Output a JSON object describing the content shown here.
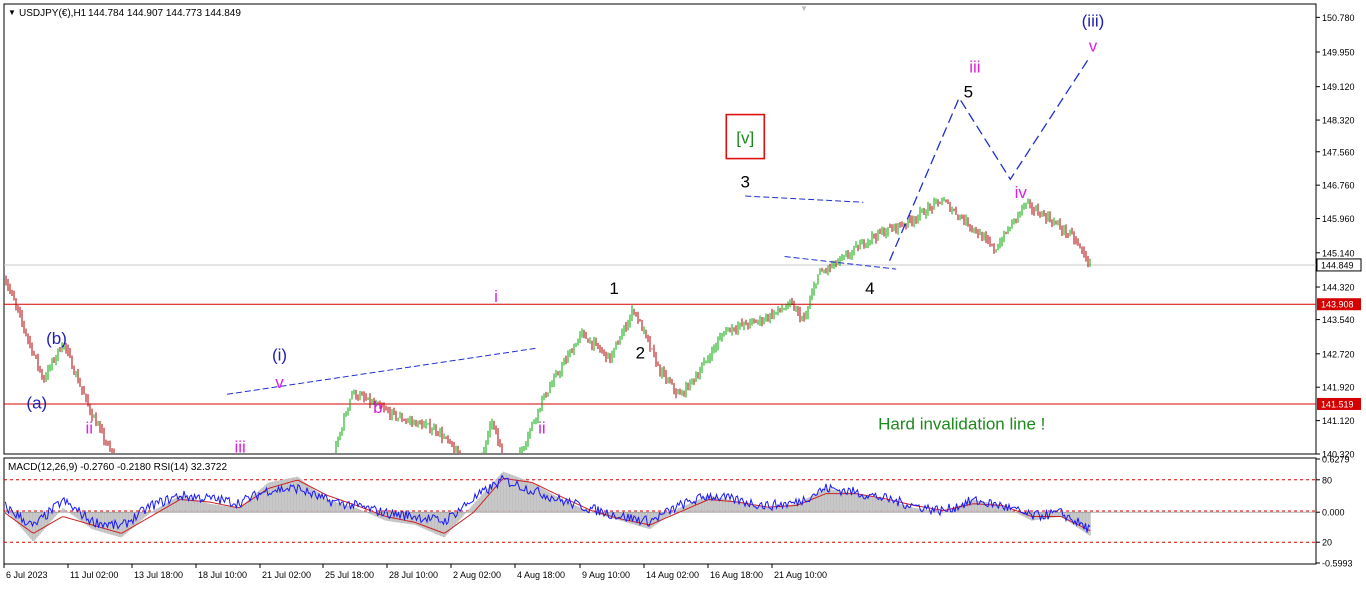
{
  "header": {
    "symbol_text": "USDJPY(€),H1",
    "ohlc_text": "144.784 144.907 144.773 144.849"
  },
  "indicator_header": {
    "text": "MACD(12,26,9) -0.2760 -0.2180 RSI(14) 32.3722"
  },
  "colors": {
    "bull": "#00aa00",
    "bear": "#b00000",
    "hline": "#d40000",
    "projection": "#1f2fd0",
    "blue_label": "#1f1fb0",
    "magenta_label": "#e020e0",
    "green_text": "#1d8a1d",
    "red_box": "#e01010",
    "rsi": "#1a1aff",
    "signal": "#cc2222",
    "hist": "#c0c0c0"
  },
  "chart_data": [
    {
      "type": "candlestick",
      "title": "",
      "symbol": "USDJPY(€)",
      "timeframe": "H1",
      "ohlc": {
        "open": 144.784,
        "high": 144.907,
        "low": 144.773,
        "close": 144.849
      },
      "ylim": [
        140.32,
        151.1
      ],
      "y_ticks": [
        "150.780",
        "149.950",
        "149.120",
        "148.320",
        "147.560",
        "146.760",
        "145.960",
        "145.140",
        "144.320",
        "143.540",
        "142.720",
        "141.920",
        "141.120",
        "140.320"
      ],
      "x_ticks": [
        "6 Jul 2023",
        "11 Jul 02:00",
        "13 Jul 18:00",
        "18 Jul 10:00",
        "21 Jul 02:00",
        "25 Jul 18:00",
        "28 Jul 10:00",
        "2 Aug 02:00",
        "4 Aug 18:00",
        "9 Aug 10:00",
        "14 Aug 02:00",
        "16 Aug 18:00",
        "21 Aug 10:00"
      ],
      "price_path": [
        {
          "t": 0,
          "p": 144.6
        },
        {
          "t": 0.03,
          "p": 142.1
        },
        {
          "t": 0.045,
          "p": 143.0
        },
        {
          "t": 0.065,
          "p": 141.4
        },
        {
          "t": 0.09,
          "p": 139.8
        },
        {
          "t": 0.15,
          "p": 138.2
        },
        {
          "t": 0.2,
          "p": 138.7
        },
        {
          "t": 0.245,
          "p": 139.6
        },
        {
          "t": 0.265,
          "p": 141.8
        },
        {
          "t": 0.3,
          "p": 141.2
        },
        {
          "t": 0.33,
          "p": 140.9
        },
        {
          "t": 0.36,
          "p": 139.8
        },
        {
          "t": 0.372,
          "p": 141.1
        },
        {
          "t": 0.385,
          "p": 139.7
        },
        {
          "t": 0.41,
          "p": 141.6
        },
        {
          "t": 0.44,
          "p": 143.2
        },
        {
          "t": 0.462,
          "p": 142.6
        },
        {
          "t": 0.48,
          "p": 143.8
        },
        {
          "t": 0.5,
          "p": 142.3
        },
        {
          "t": 0.515,
          "p": 141.7
        },
        {
          "t": 0.53,
          "p": 142.3
        },
        {
          "t": 0.55,
          "p": 143.3
        },
        {
          "t": 0.575,
          "p": 143.5
        },
        {
          "t": 0.6,
          "p": 143.9
        },
        {
          "t": 0.61,
          "p": 143.5
        },
        {
          "t": 0.62,
          "p": 144.6
        },
        {
          "t": 0.64,
          "p": 145.0
        },
        {
          "t": 0.66,
          "p": 145.5
        },
        {
          "t": 0.69,
          "p": 145.9
        },
        {
          "t": 0.715,
          "p": 146.4
        },
        {
          "t": 0.74,
          "p": 145.7
        },
        {
          "t": 0.755,
          "p": 145.2
        },
        {
          "t": 0.778,
          "p": 146.3
        },
        {
          "t": 0.795,
          "p": 146.0
        },
        {
          "t": 0.815,
          "p": 145.5
        },
        {
          "t": 0.828,
          "p": 144.85
        }
      ],
      "horizontal_lines": [
        {
          "price": 143.908,
          "label": "143.908",
          "kind": "resistance"
        },
        {
          "price": 141.519,
          "label": "141.519",
          "kind": "invalidation"
        }
      ],
      "current_price": {
        "price": 144.849,
        "label": "144.849"
      },
      "wave_labels": [
        {
          "text": "(b)",
          "color": "blue",
          "t": 0.04,
          "p": 143.1
        },
        {
          "text": "(a)",
          "color": "blue",
          "t": 0.025,
          "p": 141.55
        },
        {
          "text": "ii",
          "color": "magenta",
          "t": 0.065,
          "p": 140.95
        },
        {
          "text": "(i)",
          "color": "blue",
          "t": 0.21,
          "p": 142.7
        },
        {
          "text": "v",
          "color": "magenta",
          "t": 0.21,
          "p": 142.05
        },
        {
          "text": "iii",
          "color": "magenta",
          "t": 0.18,
          "p": 140.5
        },
        {
          "text": "b",
          "color": "magenta",
          "t": 0.285,
          "p": 141.45
        },
        {
          "text": "i",
          "color": "magenta",
          "t": 0.375,
          "p": 144.1
        },
        {
          "text": "ii",
          "color": "magenta",
          "t": 0.41,
          "p": 140.95
        },
        {
          "text": "1",
          "color": "black",
          "t": 0.465,
          "p": 144.3
        },
        {
          "text": "2",
          "color": "black",
          "t": 0.485,
          "p": 142.75
        },
        {
          "text": "3",
          "color": "black",
          "t": 0.565,
          "p": 146.85
        },
        {
          "text": "4",
          "color": "black",
          "t": 0.66,
          "p": 144.3
        },
        {
          "text": "5",
          "color": "black",
          "t": 0.735,
          "p": 149.0
        },
        {
          "text": "iii",
          "color": "magenta",
          "t": 0.74,
          "p": 149.6
        },
        {
          "text": "iv",
          "color": "magenta",
          "t": 0.775,
          "p": 146.6
        },
        {
          "text": "v",
          "color": "magenta",
          "t": 0.83,
          "p": 150.1
        },
        {
          "text": "(iii)",
          "color": "blue",
          "t": 0.83,
          "p": 150.7
        },
        {
          "text": "[v]",
          "color": "green",
          "t": 0.565,
          "p": 147.9,
          "boxed": true
        }
      ],
      "annotation": {
        "text": "Hard invalidation line !",
        "t": 0.73,
        "p": 141.0
      },
      "trendlines": [
        {
          "from": {
            "t": 0.17,
            "p": 141.75
          },
          "to": {
            "t": 0.405,
            "p": 142.85
          }
        },
        {
          "from": {
            "t": 0.565,
            "p": 146.5
          },
          "to": {
            "t": 0.655,
            "p": 146.35
          }
        },
        {
          "from": {
            "t": 0.595,
            "p": 145.05
          },
          "to": {
            "t": 0.68,
            "p": 144.75
          }
        }
      ],
      "projection": [
        {
          "t": 0.675,
          "p": 144.95
        },
        {
          "t": 0.728,
          "p": 148.85
        },
        {
          "t": 0.767,
          "p": 146.9
        },
        {
          "t": 0.828,
          "p": 149.85
        }
      ]
    },
    {
      "type": "line",
      "title": "MACD(12,26,9) -0.2760 -0.2180 RSI(14) 32.3722",
      "ylim": [
        -0.5993,
        0.6279
      ],
      "y_ticks": [
        "0.6279",
        "80",
        "0.000",
        "20",
        "-0.5993"
      ],
      "levels": [
        80,
        50,
        20
      ],
      "series": [
        {
          "name": "MACD",
          "values": [
            0.05,
            -0.35,
            0.05,
            -0.2,
            -0.3,
            0.0,
            0.2,
            0.1,
            0.05,
            0.35,
            0.42,
            0.15,
            0.05,
            -0.1,
            -0.15,
            -0.3,
            0.1,
            0.48,
            0.35,
            0.15,
            0.0,
            -0.1,
            -0.2,
            0.05,
            0.2,
            0.12,
            0.05,
            0.1,
            0.28,
            0.22,
            0.15,
            0.05,
            0.0,
            0.15,
            0.08,
            -0.1,
            -0.05,
            -0.28
          ]
        },
        {
          "name": "Signal",
          "values": [
            0.0,
            -0.25,
            -0.05,
            -0.15,
            -0.25,
            -0.05,
            0.15,
            0.12,
            0.05,
            0.28,
            0.38,
            0.2,
            0.08,
            -0.05,
            -0.12,
            -0.25,
            0.0,
            0.4,
            0.35,
            0.18,
            0.02,
            -0.08,
            -0.15,
            0.0,
            0.15,
            0.12,
            0.06,
            0.08,
            0.22,
            0.22,
            0.16,
            0.08,
            0.02,
            0.1,
            0.08,
            -0.05,
            -0.05,
            -0.22
          ]
        },
        {
          "name": "RSI(14)",
          "values": [
            55,
            35,
            60,
            40,
            35,
            55,
            65,
            62,
            58,
            70,
            72,
            60,
            55,
            48,
            45,
            40,
            62,
            80,
            70,
            60,
            52,
            45,
            40,
            55,
            65,
            60,
            55,
            58,
            72,
            68,
            62,
            55,
            50,
            60,
            55,
            45,
            48,
            32
          ]
        }
      ]
    }
  ]
}
